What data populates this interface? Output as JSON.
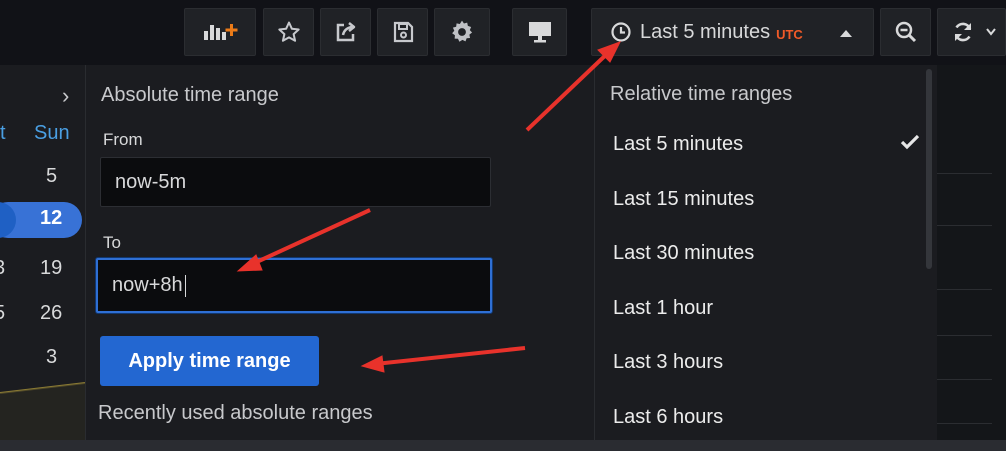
{
  "toolbar": {
    "buttons": [
      {
        "name": "add-panel",
        "icon": "add-panel-icon"
      },
      {
        "name": "star",
        "icon": "star-icon"
      },
      {
        "name": "share",
        "icon": "share-icon"
      },
      {
        "name": "save",
        "icon": "save-icon"
      },
      {
        "name": "settings",
        "icon": "gear-icon"
      },
      {
        "name": "view-mode",
        "icon": "monitor-icon"
      },
      {
        "name": "zoom-out",
        "icon": "zoom-out-icon"
      },
      {
        "name": "refresh",
        "icon": "refresh-icon"
      }
    ],
    "time_picker": {
      "label": "Last 5 minutes",
      "timezone": "UTC"
    }
  },
  "calendar": {
    "nav_next": "›",
    "weekday_partial": "t",
    "weekday_last": "Sun",
    "rows": [
      {
        "left": "",
        "right": "5"
      },
      {
        "left": "",
        "right": "12",
        "selected": true
      },
      {
        "left": "3",
        "right": "19"
      },
      {
        "left": "5",
        "right": "26"
      },
      {
        "left": "",
        "right": "3"
      }
    ]
  },
  "absolute_range": {
    "title": "Absolute time range",
    "from_label": "From",
    "from_value": "now-5m",
    "to_label": "To",
    "to_value": "now+8h",
    "apply_label": "Apply time range",
    "recent_title": "Recently used absolute ranges"
  },
  "relative_ranges": {
    "title": "Relative time ranges",
    "items": [
      {
        "label": "Last 5 minutes",
        "selected": true
      },
      {
        "label": "Last 15 minutes"
      },
      {
        "label": "Last 30 minutes"
      },
      {
        "label": "Last 1 hour"
      },
      {
        "label": "Last 3 hours"
      },
      {
        "label": "Last 6 hours"
      }
    ]
  },
  "colors": {
    "accent_blue": "#2367d1",
    "utc_orange": "#f05a28",
    "annotation_red": "#e8322b"
  }
}
